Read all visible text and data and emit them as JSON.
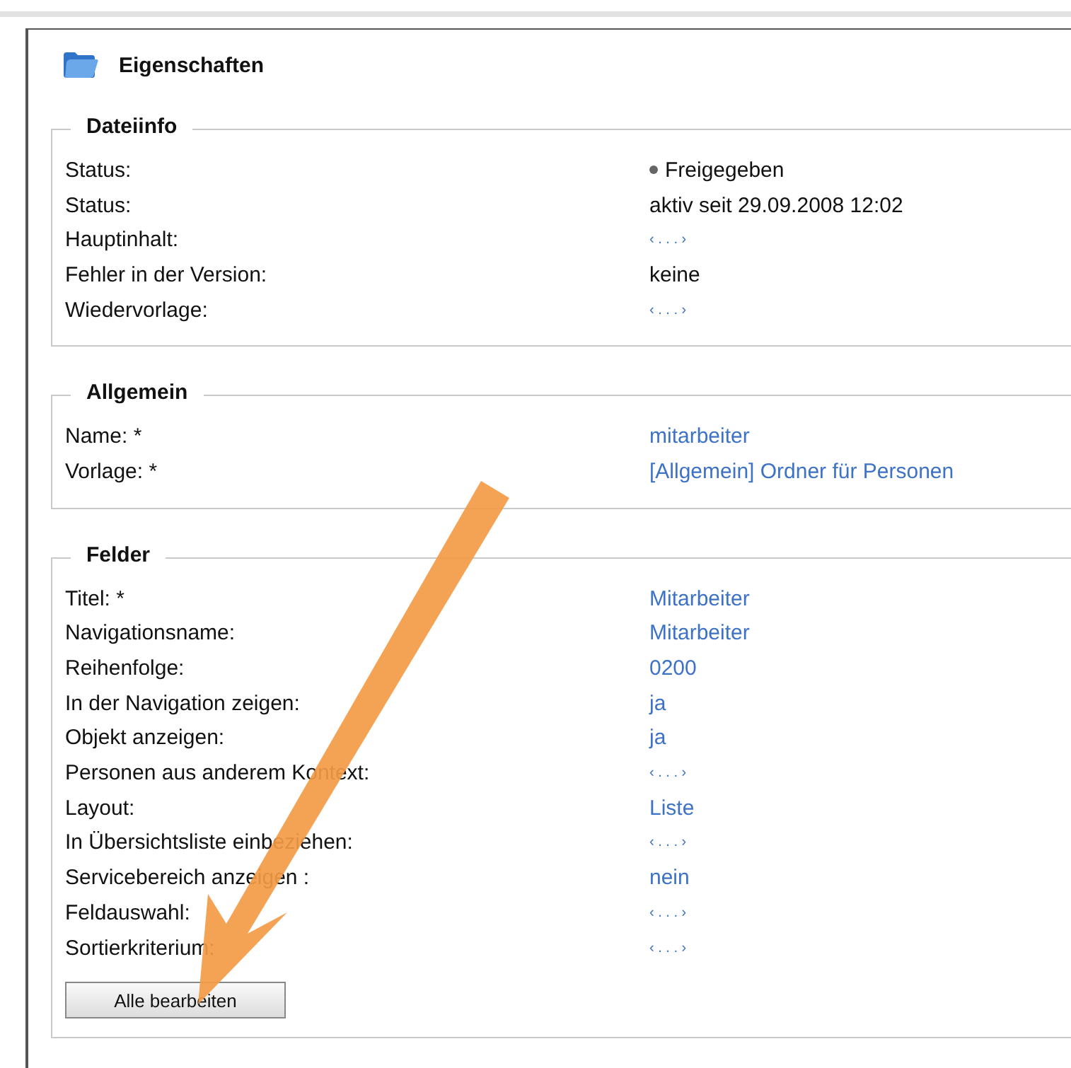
{
  "title": "Eigenschaften",
  "sections": [
    {
      "legend": "Dateiinfo",
      "rows": [
        {
          "label": "Status:",
          "value": "Freigegeben",
          "kind": "status"
        },
        {
          "label": "Status:",
          "value": "aktiv seit 29.09.2008 12:02",
          "kind": "text"
        },
        {
          "label": "Hauptinhalt:",
          "value": "‹ . . . ›",
          "kind": "empty"
        },
        {
          "label": "Fehler in der Version:",
          "value": "keine",
          "kind": "text"
        },
        {
          "label": "Wiedervorlage:",
          "value": "‹ . . . ›",
          "kind": "empty"
        }
      ]
    },
    {
      "legend": "Allgemein",
      "rows": [
        {
          "label": "Name: *",
          "value": "mitarbeiter",
          "kind": "link"
        },
        {
          "label": "Vorlage: *",
          "value": "[Allgemein] Ordner für Personen",
          "kind": "link"
        }
      ]
    },
    {
      "legend": "Felder",
      "rows": [
        {
          "label": "Titel: *",
          "value": "Mitarbeiter",
          "kind": "link"
        },
        {
          "label": "Navigationsname:",
          "value": "Mitarbeiter",
          "kind": "link"
        },
        {
          "label": "Reihenfolge:",
          "value": "0200",
          "kind": "link"
        },
        {
          "label": "In der Navigation zeigen:",
          "value": "ja",
          "kind": "link"
        },
        {
          "label": "Objekt anzeigen:",
          "value": "ja",
          "kind": "link"
        },
        {
          "label": "Personen aus anderem Kontext:",
          "value": "‹ . . . ›",
          "kind": "empty"
        },
        {
          "label": "Layout:",
          "value": "Liste",
          "kind": "link"
        },
        {
          "label": "In Übersichtsliste einbeziehen:",
          "value": "‹ . . . ›",
          "kind": "empty"
        },
        {
          "label": "Servicebereich anzeigen :",
          "value": "nein",
          "kind": "link"
        },
        {
          "label": "Feldauswahl:",
          "value": "‹ . . . ›",
          "kind": "empty"
        },
        {
          "label": "Sortierkriterium:",
          "value": "‹ . . . ›",
          "kind": "empty"
        }
      ],
      "button": "Alle bearbeiten"
    }
  ]
}
